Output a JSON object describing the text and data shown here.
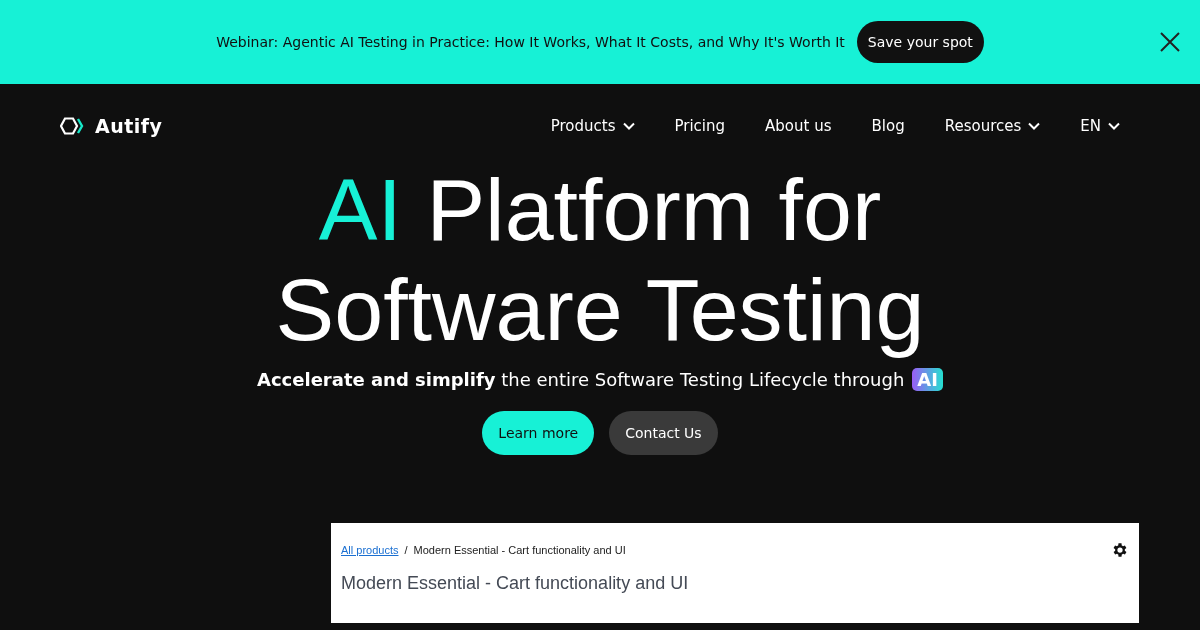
{
  "banner": {
    "text": "Webinar: Agentic AI Testing in Practice: How It Works, What It Costs, and Why It's Worth It",
    "button": "Save your spot"
  },
  "nav": {
    "logo": "Autify",
    "items": [
      {
        "label": "Products",
        "dropdown": true
      },
      {
        "label": "Pricing",
        "dropdown": false
      },
      {
        "label": "About us",
        "dropdown": false
      },
      {
        "label": "Blog",
        "dropdown": false
      },
      {
        "label": "Resources",
        "dropdown": true
      },
      {
        "label": "EN",
        "dropdown": true
      }
    ]
  },
  "hero": {
    "title_accent": "AI",
    "title_rest": "Platform for",
    "title_line2": "Software Testing",
    "subtitle": "**Accelerate and simplify** the entire Software Testing Lifecycle through",
    "subtitle_badge": "AI",
    "buttons": [
      {
        "label": "Learn more",
        "kind": "primary"
      },
      {
        "label": "Contact Us",
        "kind": "secondary"
      }
    ]
  },
  "preview": {
    "breadcrumb_link": "All products",
    "breadcrumb_separator": "/",
    "breadcrumb_current": "Modern Essential - Cart functionality and UI",
    "heading": "Modern Essential - Cart functionality and UI"
  }
}
